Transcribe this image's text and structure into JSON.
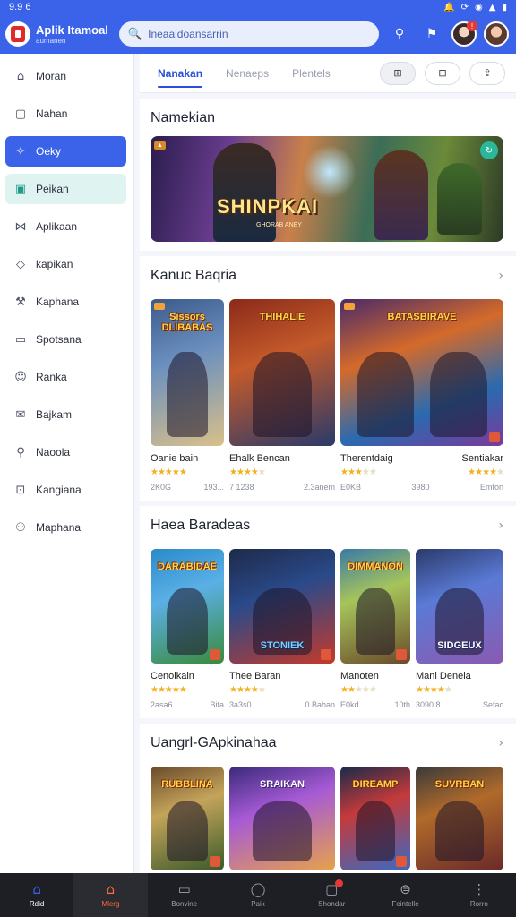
{
  "status": {
    "time": "9.9 6",
    "icons": [
      "bell-icon",
      "sync-icon",
      "wifi-icon",
      "signal-icon",
      "battery-icon"
    ]
  },
  "app": {
    "title": "Aplik Itamoal",
    "subtitle": "aumanen"
  },
  "search": {
    "value": "Ineaaldoansarrin"
  },
  "sidebar": {
    "items": [
      {
        "label": "Moran",
        "icon": "home-icon"
      },
      {
        "label": "Nahan",
        "icon": "bookmark-icon"
      },
      {
        "label": "Oeky",
        "icon": "compass-icon",
        "state": "active"
      },
      {
        "label": "Peikan",
        "icon": "tag-icon",
        "state": "highlight"
      },
      {
        "label": "Aplikaan",
        "icon": "chart-icon"
      },
      {
        "label": "kapikan",
        "icon": "shield-icon"
      },
      {
        "label": "Kaphana",
        "icon": "tools-icon"
      },
      {
        "label": "Spotsana",
        "icon": "tablet-icon"
      },
      {
        "label": "Ranka",
        "icon": "smile-icon"
      },
      {
        "label": "Bajkam",
        "icon": "mail-icon"
      },
      {
        "label": "Naoola",
        "icon": "search-icon"
      },
      {
        "label": "Kangiana",
        "icon": "chart-box-icon"
      },
      {
        "label": "Maphana",
        "icon": "people-icon"
      }
    ]
  },
  "tabs": [
    "Nanakan",
    "Nenaeps",
    "Plentels"
  ],
  "featured": {
    "heading": "Namekian",
    "banner_title": "SHINPKAI",
    "banner_sub": "GHORAB ANEY"
  },
  "section1": {
    "heading": "Kanuc Baqria",
    "cards": [
      {
        "title": "Oanie bain",
        "banner": "Sissors DLIBABAS",
        "stars": 5,
        "meta_left": "2K0G",
        "meta_right": "193..."
      },
      {
        "title": "Ehalk Bencan",
        "banner": "THIHALIE",
        "stars": 4,
        "meta_left": "7 1238",
        "meta_right": ""
      },
      {
        "title": "Therentdaig",
        "banner": "BATASBIRAVE",
        "stars": 3,
        "meta_left": "9908",
        "meta_right": "",
        "wide": true
      },
      {
        "title": "Sentiakar",
        "banner": "",
        "stars": 4,
        "meta_left": "3969 8",
        "meta_right": "Emfon"
      }
    ],
    "extra_meta": [
      "2.3anem",
      "E0KB",
      "3980"
    ]
  },
  "section2": {
    "heading": "Haea Baradeas",
    "cards": [
      {
        "title": "Cenolkain",
        "banner": "DARABIDAE",
        "stars": 5,
        "meta_left": "2asa6",
        "meta_right": "Bifa"
      },
      {
        "title": "Thee Baran",
        "banner": "STONIEK",
        "stars": 4,
        "meta_left": "3a3s0",
        "meta_right": "0 Bahan"
      },
      {
        "title": "Manoten",
        "banner": "DIMMANON",
        "stars": 2,
        "meta_left": "E0kd",
        "meta_right": "10th"
      },
      {
        "title": "Mani Deneia",
        "banner": "SIDGEUX",
        "stars": 4,
        "meta_left": "3090 8",
        "meta_right": "Sefac"
      }
    ]
  },
  "section3": {
    "heading": "Uangrl-GApkinahaa",
    "cards": [
      {
        "banner": "RUBBLINA"
      },
      {
        "banner": "SRAIKAN"
      },
      {
        "banner": "DIREAMP"
      },
      {
        "banner": "SUVRBAN"
      }
    ]
  },
  "bottomnav": [
    {
      "label": "Rdid",
      "icon": "home-icon"
    },
    {
      "label": "Mlerg",
      "icon": "house-icon"
    },
    {
      "label": "Bonvine",
      "icon": "monitor-icon"
    },
    {
      "label": "Paik",
      "icon": "circle-icon"
    },
    {
      "label": "Shondar",
      "icon": "download-icon"
    },
    {
      "label": "Feintelle",
      "icon": "sliders-icon"
    },
    {
      "label": "Rorro",
      "icon": "more-icon"
    }
  ],
  "colors": {
    "accent": "#3a63ea",
    "star": "#f2b01e",
    "nav": "#1d1f24"
  }
}
